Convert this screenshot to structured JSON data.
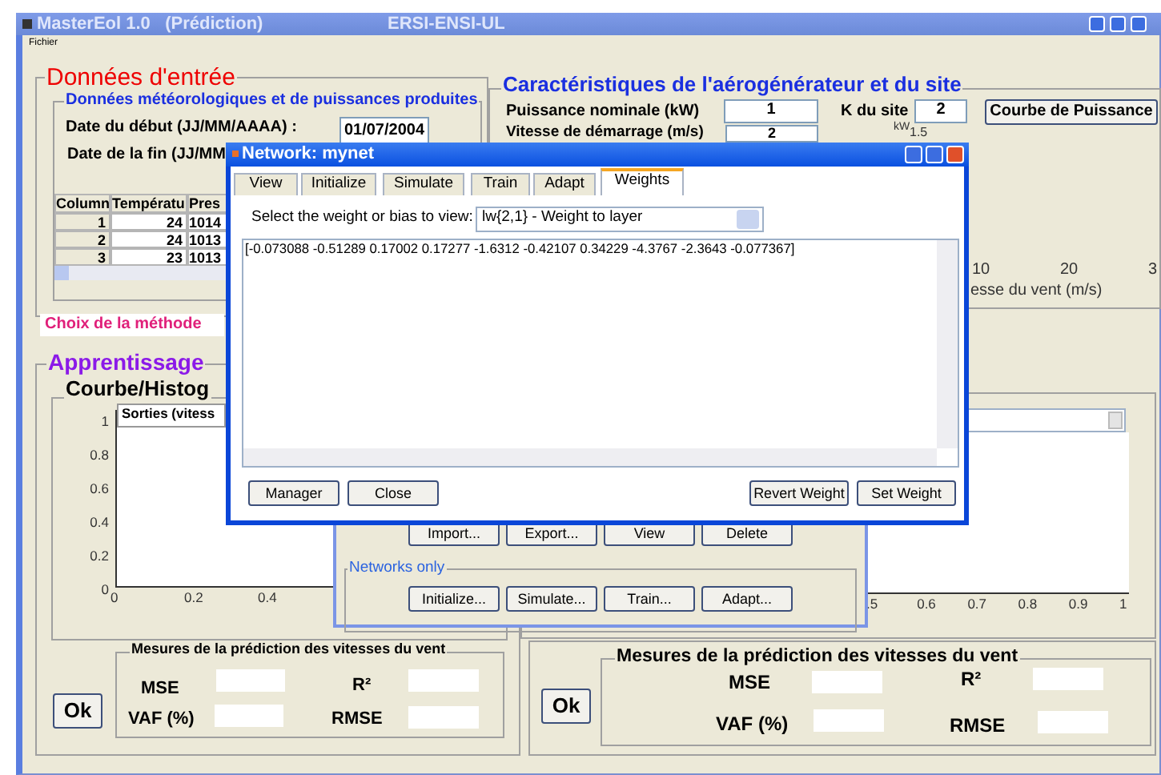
{
  "window": {
    "title": "MasterEol 1.0   (Prédiction)",
    "org": "ERSI-ENSI-UL"
  },
  "menu": [
    "Fichier"
  ],
  "input_data": {
    "title": "Données d'entrée",
    "weather_title": "Données météorologiques et de puissances produites",
    "start_label": "Date du  début (JJ/MM/AAAA) :",
    "start_value": "01/07/2004",
    "end_label": "Date de la fin  (JJ/MM",
    "table": {
      "columns": [
        "Column",
        "Températu",
        "Pres"
      ],
      "rows": [
        [
          "1",
          "24",
          "1014"
        ],
        [
          "2",
          "24",
          "1013"
        ],
        [
          "3",
          "23",
          "1013"
        ]
      ]
    }
  },
  "turbine": {
    "title": "Caractéristiques de l'aérogénérateur et du site",
    "rated_power_label": "Puissance nominale (kW)",
    "rated_power": "1",
    "k_label": "K du site",
    "k_value": "2",
    "curve_button": "Courbe de Puissance",
    "startup_label": "Vitesse de démarrage (m/s)",
    "startup_value": "2",
    "curve": {
      "ylabel": "kW",
      "ytick": "1.5",
      "xticks": [
        "10",
        "20",
        "3"
      ],
      "xlabel": "esse du vent (m/s)"
    }
  },
  "method_label": "Choix de la méthode",
  "learning": {
    "title": "Apprentissage",
    "plot_title": "Courbe/Histog",
    "left_chart": {
      "legend": "Sorties (vitess",
      "yticks": [
        "1",
        "0.8",
        "0.6",
        "0.4",
        "0.2",
        "0"
      ],
      "xticks": [
        "0",
        "0.2",
        "0.4"
      ]
    },
    "right_chart": {
      "xticks": [
        ".5",
        "0.6",
        "0.7",
        "0.8",
        "0.9",
        "1"
      ]
    }
  },
  "measures": [
    {
      "title": "Mesures de la prédiction des vitesses du vent",
      "labels": [
        "MSE",
        "R²",
        "VAF (%)",
        "RMSE"
      ],
      "ok": "Ok"
    },
    {
      "title": "Mesures de la prédiction des vitesses du vent",
      "labels": [
        "MSE",
        "R²",
        "VAF (%)",
        "RMSE"
      ],
      "ok": "Ok"
    }
  ],
  "network_manager": {
    "buttons": [
      "Import...",
      "Export...",
      "View",
      "Delete"
    ],
    "group": "Networks only",
    "network_buttons": [
      "Initialize...",
      "Simulate...",
      "Train...",
      "Adapt..."
    ]
  },
  "network_dialog": {
    "title": "Network: mynet",
    "tabs": [
      {
        "label": "View",
        "selected": false
      },
      {
        "label": "Initialize",
        "selected": false
      },
      {
        "label": "Simulate",
        "selected": false
      },
      {
        "label": "Train",
        "selected": false
      },
      {
        "label": "Adapt",
        "selected": false
      },
      {
        "label": "Weights",
        "selected": true
      }
    ],
    "select_label": "Select the weight or bias to view:",
    "selected_item": "lw{2,1} - Weight to layer",
    "weights": "[-0.073088 -0.51289 0.17002 0.17277 -1.6312 -0.42107 0.34229 -4.3767 -2.3643 -0.077367]",
    "buttons_left": [
      "Manager",
      "Close"
    ],
    "buttons_right": [
      "Revert Weight",
      "Set Weight"
    ]
  }
}
